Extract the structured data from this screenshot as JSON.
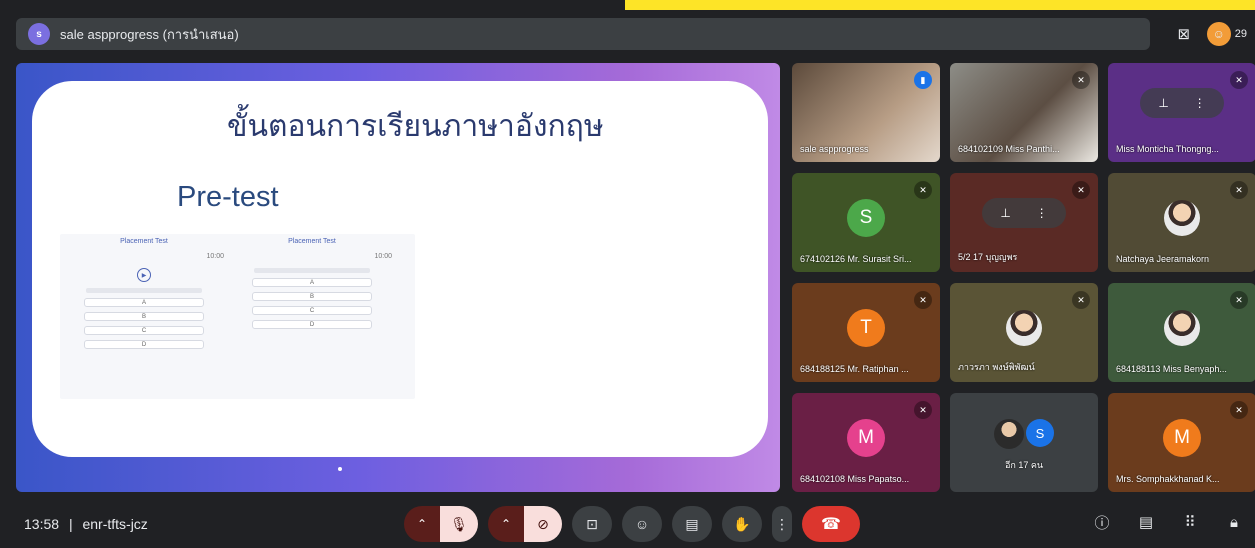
{
  "header": {
    "presenter_initial": "s",
    "title": "sale aspprogress (การนำเสนอ)",
    "people_count": "29",
    "icons": [
      "screen-share-off-icon",
      "people-icon"
    ]
  },
  "slide": {
    "title": "ขั้นตอนการเรียนภาษาอังกฤษ",
    "subtitle": "Pre-test",
    "test_left_title": "Placement Test",
    "test_right_title": "Placement Test",
    "timer_left": "10:00",
    "timer_right": "10:00",
    "options_left": [
      "A",
      "B",
      "C",
      "D"
    ],
    "options_right": [
      "A",
      "B",
      "C",
      "D"
    ]
  },
  "tiles": [
    {
      "name": "sale aspprogress",
      "type": "video",
      "bg": "#8a7868",
      "indicator": "speaking"
    },
    {
      "name": "684102109 Miss Panthi...",
      "type": "video",
      "bg": "#6e6256",
      "indicator": "muted"
    },
    {
      "name": "Miss Monticha Thongng...",
      "type": "pinned",
      "bg": "#5b2f86",
      "indicator": "muted"
    },
    {
      "name": "674102126 Mr. Surasit Sri...",
      "type": "letter",
      "letter": "S",
      "bg": "#3f5426",
      "avatar_color": "#4ca84a",
      "indicator": "muted"
    },
    {
      "name": "5/2 17 บุญญพร",
      "type": "pinned",
      "bg": "#5a2a25",
      "indicator": "muted"
    },
    {
      "name": "Natchaya Jeeramakorn",
      "type": "photo",
      "bg": "#514b35",
      "indicator": "muted"
    },
    {
      "name": "684188125 Mr. Ratiphan ...",
      "type": "letter",
      "letter": "T",
      "bg": "#6b3c1d",
      "avatar_color": "#f07b1c",
      "indicator": "muted"
    },
    {
      "name": "ภาวรภา พงษ์พิพัฒน์",
      "type": "photo",
      "bg": "#5a5436",
      "indicator": "muted"
    },
    {
      "name": "684188113 Miss Benyaph...",
      "type": "photo",
      "bg": "#3e5a3c",
      "indicator": "muted"
    },
    {
      "name": "684102108 Miss Papatso...",
      "type": "letter",
      "letter": "M",
      "bg": "#6a1f45",
      "avatar_color": "#e5418d",
      "indicator": "muted"
    },
    {
      "name": "อีก 17 คน",
      "type": "others",
      "letter": "S",
      "bg": "#3c4043",
      "avatar_color": "#1a73e8",
      "indicator": "none"
    },
    {
      "name": "Mrs. Somphakkhanad K...",
      "type": "letter",
      "letter": "M",
      "bg": "#6b3c1d",
      "avatar_color": "#f07b1c",
      "indicator": "muted"
    }
  ],
  "bottom": {
    "time": "13:58",
    "separator": "|",
    "meeting_code": "enr-tfts-jcz"
  },
  "colors": {
    "leave": "#dc362e",
    "mic_off_bg": "#f9dedc",
    "accent_yellow": "#fde427"
  }
}
